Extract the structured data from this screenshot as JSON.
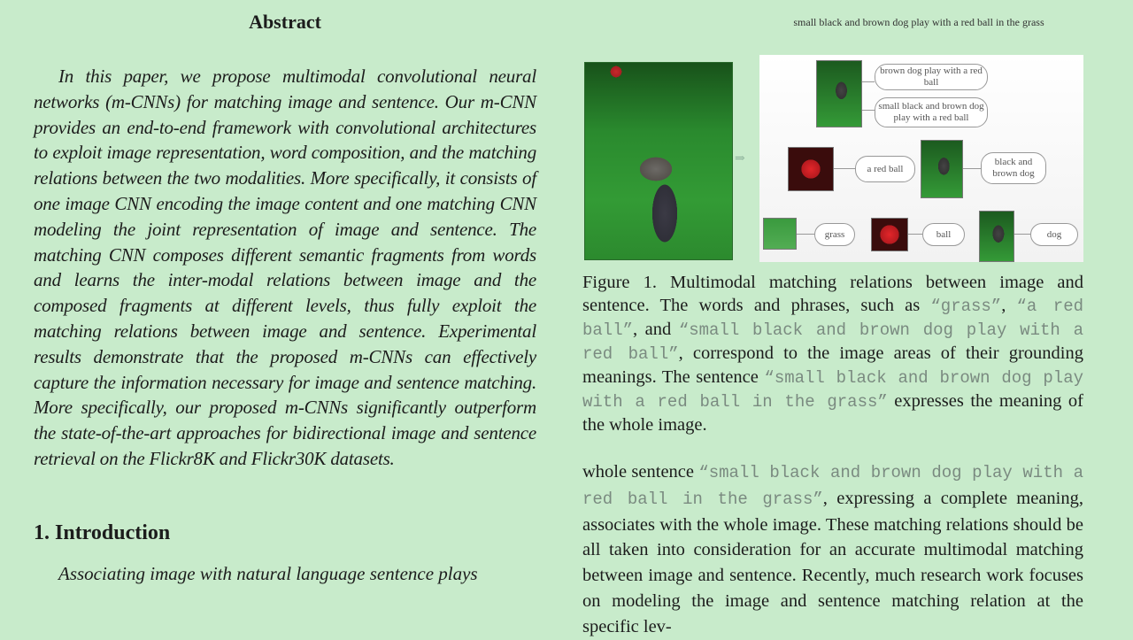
{
  "abstract": {
    "title": "Abstract",
    "text": "In this paper, we propose multimodal convolutional neural networks (m-CNNs) for matching image and sentence. Our m-CNN provides an end-to-end framework with convolutional architectures to exploit image representation, word composition, and the matching relations between the two modalities. More specifically, it consists of one image CNN encoding the image content and one matching CNN modeling the joint representation of image and sentence. The matching CNN composes different semantic fragments from words and learns the inter-modal relations between image and the composed fragments at different levels, thus fully exploit the matching relations between image and sentence. Experimental results demonstrate that the proposed m-CNNs can effectively capture the information necessary for image and sentence matching. More specifically, our proposed m-CNNs significantly outperform the state-of-the-art approaches for bidirectional image and sentence retrieval on the Flickr8K and Flickr30K datasets."
  },
  "introduction": {
    "heading": "1. Introduction",
    "text": "Associating image with natural language sentence plays"
  },
  "figure": {
    "top_label": "small black and brown dog play with a red ball in the grass",
    "phrases": {
      "p1": "brown dog play with a red ball",
      "p2": "small black and brown dog play with a red ball",
      "p3": "a red ball",
      "p4": "black and brown dog",
      "p5": "grass",
      "p6": "ball",
      "p7": "dog"
    },
    "caption_parts": {
      "a": "Figure 1. Multimodal matching relations between image and sentence. The words and phrases, such as ",
      "q1": "“grass”",
      "b": ", ",
      "q2": "“a red ball”",
      "c": ", and ",
      "q3": "“small black and brown dog play with a red ball”",
      "d": ", correspond to the image areas of their grounding meanings. The sentence ",
      "q4": "“small black and brown dog play with a red ball in the grass”",
      "e": " expresses the meaning of the whole image."
    }
  },
  "right_body": {
    "a": "whole sentence ",
    "q": "“small black and brown dog play with a red ball in the grass”",
    "b": ", expressing a complete meaning, associates with the whole image. These matching relations should be all taken into consideration for an accurate multimodal matching between image and sentence. Recently, much research work focuses on modeling the image and sentence matching relation at the specific lev-"
  }
}
